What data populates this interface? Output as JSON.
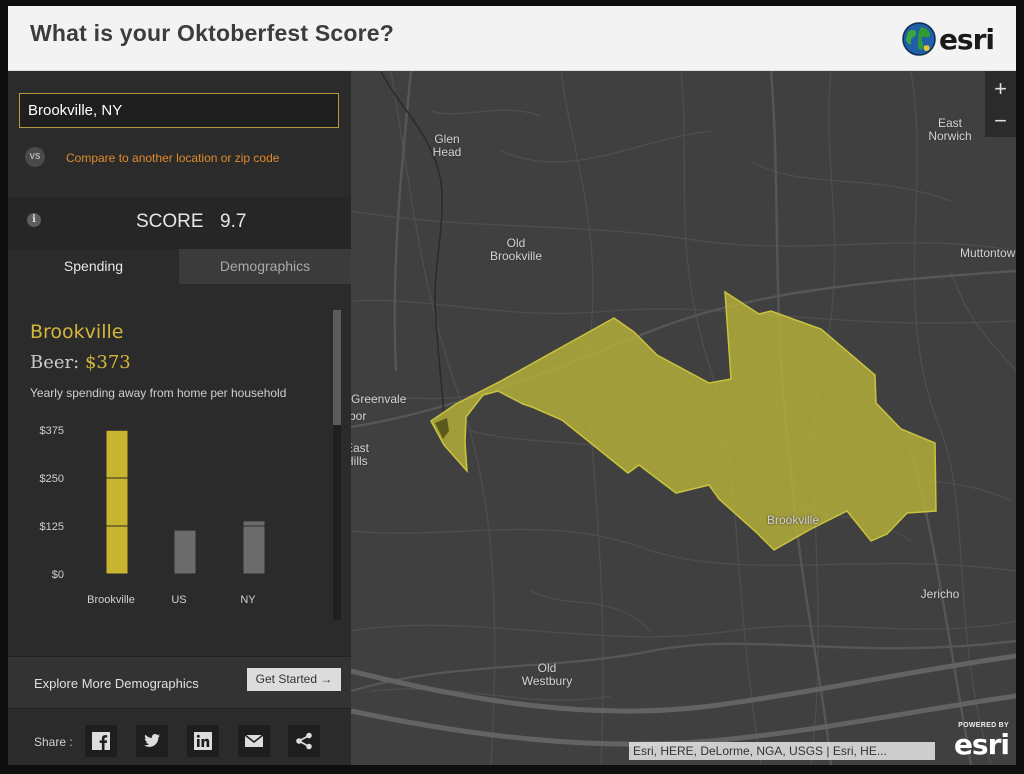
{
  "header": {
    "title": "What is your Oktoberfest Score?",
    "logo_text": "esri"
  },
  "sidebar": {
    "search_value": "Brookville, NY",
    "vs_label": "VS",
    "compare_link": "Compare to another location or zip code",
    "score_label": "SCORE",
    "score_value": "9.7",
    "tabs": [
      {
        "label": "Spending",
        "active": true
      },
      {
        "label": "Demographics",
        "active": false
      }
    ],
    "location_name": "Brookville",
    "beer_prefix": "Beer: ",
    "beer_amount": "$373",
    "description": "Yearly spending away from home per household",
    "explore_label": "Explore More Demographics",
    "get_started": "Get Started →",
    "share_label": "Share :",
    "share_icons": [
      "facebook-icon",
      "twitter-icon",
      "linkedin-icon",
      "email-icon",
      "share-icon"
    ]
  },
  "chart_data": {
    "type": "bar",
    "categories": [
      "Brookville",
      "US",
      "NY"
    ],
    "values": [
      373,
      113,
      137
    ],
    "ylim": [
      0,
      375
    ],
    "yticks": [
      0,
      125,
      250,
      375
    ],
    "ytick_labels": [
      "$0",
      "$125",
      "$250",
      "$375"
    ],
    "colors": [
      "#c8b42f",
      "#6b6b6b",
      "#6b6b6b"
    ],
    "title": "",
    "xlabel": "",
    "ylabel": ""
  },
  "map": {
    "labels": [
      {
        "text": "Glen\nHead"
      },
      {
        "text": "Old\nBrookville"
      },
      {
        "text": "East\nNorwich"
      },
      {
        "text": "Muttontown"
      },
      {
        "text": "Greenvale"
      },
      {
        "text": "bor"
      },
      {
        "text": "East\nHills"
      },
      {
        "text": "Brookville"
      },
      {
        "text": "Jericho"
      },
      {
        "text": "Old\nWestbury"
      }
    ],
    "zoom_in": "+",
    "zoom_out": "−",
    "attribution": "Esri, HERE, DeLorme, NGA, USGS | Esri, HE...",
    "powered_by": "POWERED BY",
    "powered_logo": "esri",
    "highlight_color": "#b8b23a"
  }
}
